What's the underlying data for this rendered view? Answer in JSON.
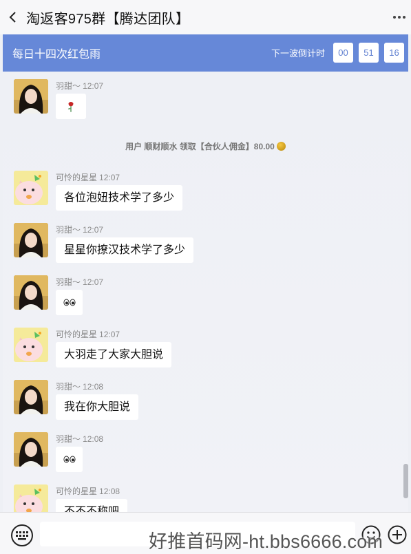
{
  "header": {
    "title": "淘返客975群【腾达团队】",
    "back_icon": "chevron-left-icon",
    "more_icon": "more-dots-icon"
  },
  "banner": {
    "title": "每日十四次红包雨",
    "countdown_label": "下一波倒计时",
    "countdown": [
      "00",
      "51",
      "16"
    ],
    "color": "#6688d8"
  },
  "messages": [
    {
      "sender": "羽甜～",
      "time": "12:07",
      "text": "",
      "emoji": "rose-icon",
      "avatar": "girl-avatar"
    },
    {
      "sender": "可怜的星星",
      "time": "12:07",
      "text": "各位泡妞技术学了多少",
      "emoji": "",
      "avatar": "dino-avatar"
    },
    {
      "sender": "羽甜～",
      "time": "12:07",
      "text": "星星你撩汉技术学了多少",
      "emoji": "",
      "avatar": "girl-avatar"
    },
    {
      "sender": "羽甜～",
      "time": "12:07",
      "text": "",
      "emoji": "eyes-icon",
      "avatar": "girl-avatar"
    },
    {
      "sender": "可怜的星星",
      "time": "12:07",
      "text": "大羽走了大家大胆说",
      "emoji": "",
      "avatar": "dino-avatar"
    },
    {
      "sender": "羽甜～",
      "time": "12:08",
      "text": "我在你大胆说",
      "emoji": "",
      "avatar": "girl-avatar"
    },
    {
      "sender": "羽甜～",
      "time": "12:08",
      "text": "",
      "emoji": "eyes-icon",
      "avatar": "girl-avatar"
    },
    {
      "sender": "可怜的星星",
      "time": "12:08",
      "text": "不不不称吧",
      "emoji": "",
      "avatar": "dino-avatar"
    }
  ],
  "system_notice": {
    "text": "用户 顺财顺水 领取【合伙人佣金】80.00",
    "icon": "coin-icon"
  },
  "input_bar": {
    "keyboard_icon": "keyboard-icon",
    "smile_icon": "smile-icon",
    "plus_icon": "plus-icon",
    "placeholder": ""
  },
  "watermark": "好推首码网-ht.bbs6666.com"
}
